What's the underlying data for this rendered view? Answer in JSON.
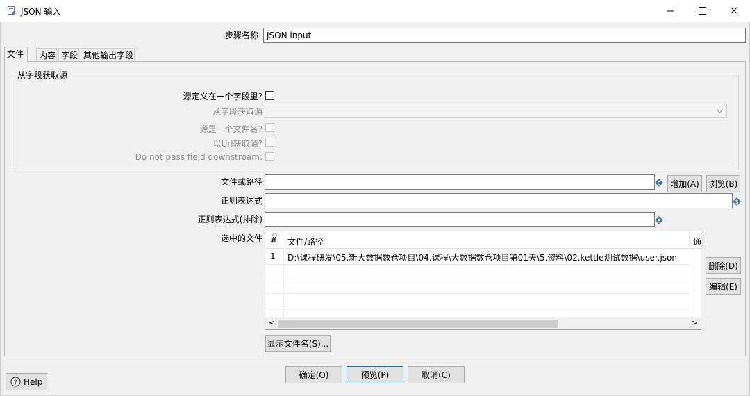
{
  "window": {
    "title": "JSON 输入",
    "icon": "json-input-icon",
    "minimize_glyph": "—",
    "maximize_glyph": "☐",
    "close_glyph": "✕"
  },
  "step_name": {
    "label": "步骤名称",
    "value": "JSON input"
  },
  "tabs": [
    "文件",
    "内容",
    "字段",
    "其他输出字段"
  ],
  "source_group": {
    "title": "从字段获取源",
    "source_in_field_label": "源定义在一个字段里?",
    "source_field_label": "从字段获取源",
    "source_is_filename_label": "源是一个文件名?",
    "read_source_as_url_label": "以Url获取源?",
    "do_not_pass_label": "Do not pass field downstream:"
  },
  "file_or_path": {
    "label": "文件或路径",
    "value": "",
    "add_button": "增加(A)",
    "browse_button": "浏览(B)"
  },
  "regex": {
    "label": "正则表达式",
    "value": ""
  },
  "regex_exclude": {
    "label": "正则表达式(排除)",
    "value": ""
  },
  "selected_files": {
    "label": "选中的文件",
    "columns": [
      "#",
      "文件/路径",
      "通"
    ],
    "rows": [
      {
        "num": "1",
        "path": "D:\\课程研发\\05.新大数据数仓项目\\04.课程\\大数据数仓项目第01天\\5.资料\\02.kettle测试数据\\user.json"
      }
    ],
    "delete_button": "删除(D)",
    "edit_button": "编辑(E)",
    "scroll_left": "<",
    "scroll_right": ">"
  },
  "show_filenames_button": "显示文件名(S)...",
  "footer": {
    "ok_button": "确定(O)",
    "preview_button": "预览(P)",
    "cancel_button": "取消(C)",
    "help_button": "Help"
  },
  "colors": {
    "primary_border": "#0078d7",
    "dialog_bg": "#f0f0f0",
    "var_icon": "#4a7aa3"
  }
}
